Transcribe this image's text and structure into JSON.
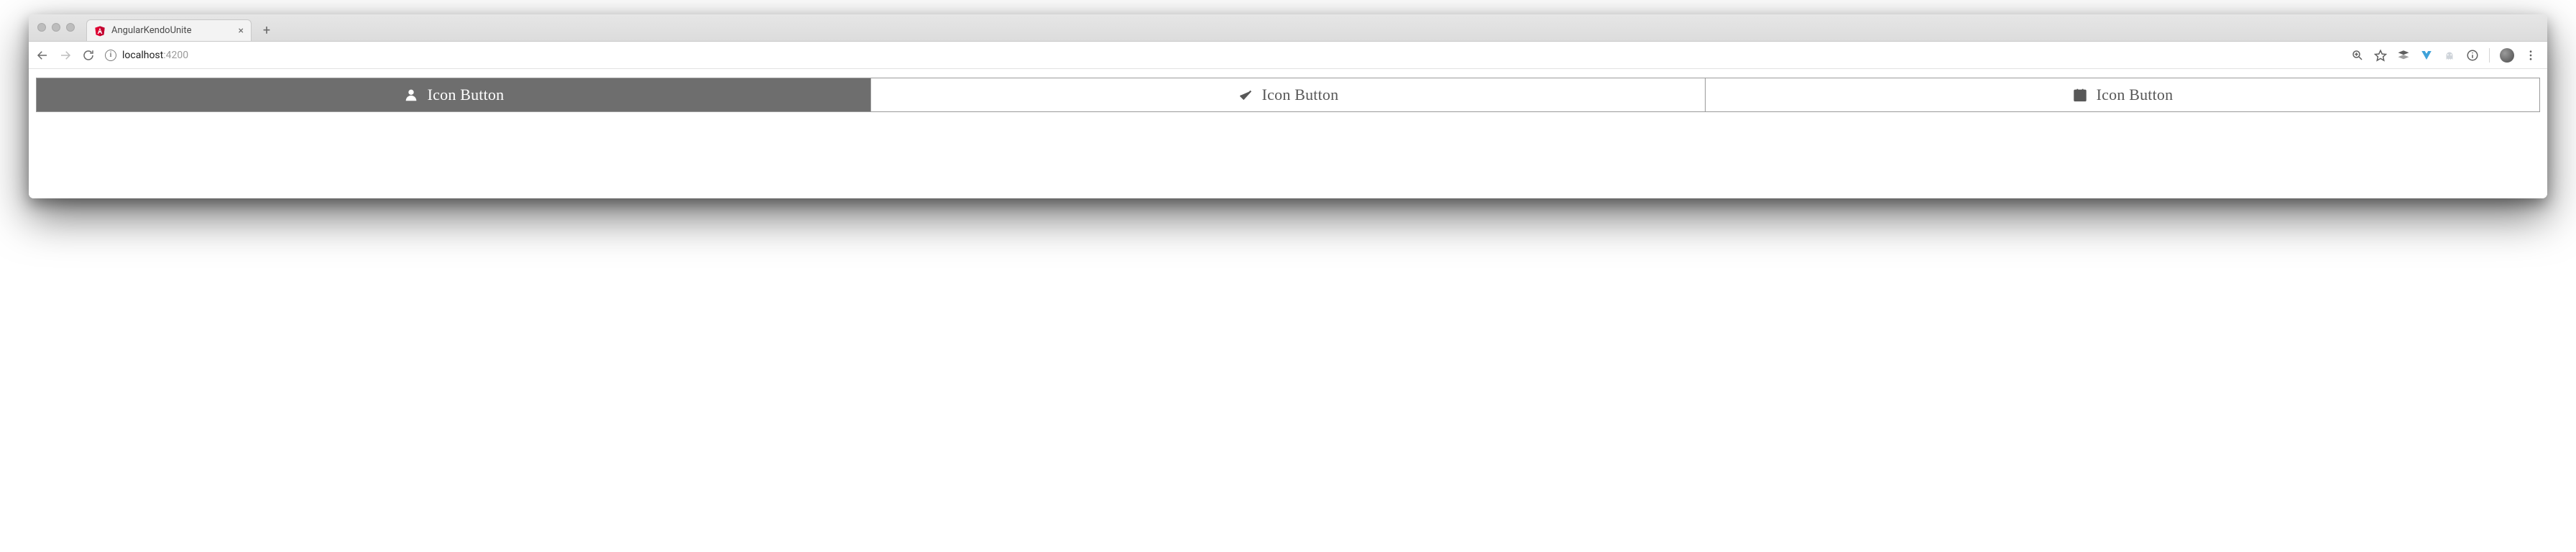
{
  "browser": {
    "tab_title": "AngularKendoUnite",
    "url_host": "localhost",
    "url_port": ":4200"
  },
  "button_group": {
    "items": [
      {
        "label": "Icon Button",
        "icon": "user",
        "selected": true
      },
      {
        "label": "Icon Button",
        "icon": "check",
        "selected": false
      },
      {
        "label": "Icon Button",
        "icon": "calendar",
        "selected": false
      }
    ]
  },
  "colors": {
    "selected_bg": "#6e6e6e",
    "selected_fg": "#ffffff",
    "border": "#9a9a9a",
    "text": "#585858"
  }
}
